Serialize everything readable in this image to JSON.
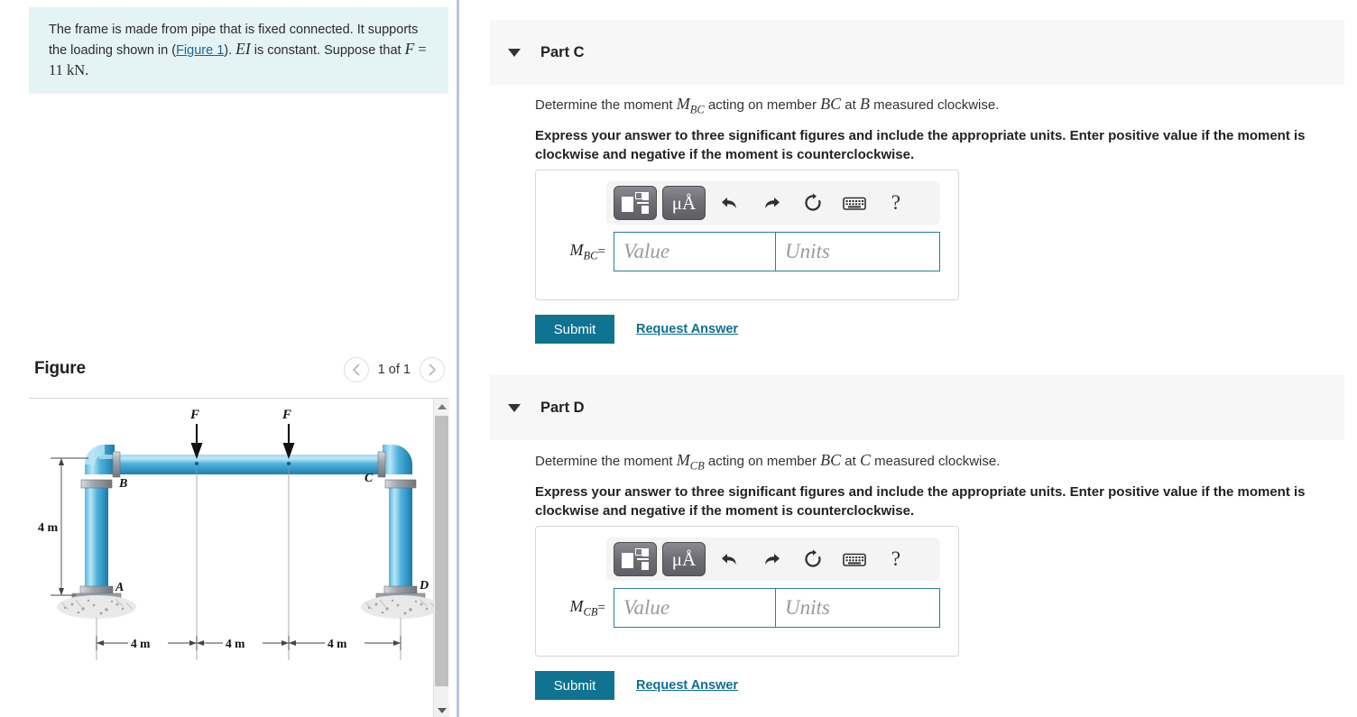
{
  "problem": {
    "line1_a": "The frame is made from pipe that is fixed connected. It supports the loading shown in (",
    "figure_link": "Figure 1",
    "line1_b": "). ",
    "EI": "EI",
    "line1_c": " is constant. Suppose that ",
    "F": "F",
    "line1_d": " = 11 kN."
  },
  "figure_panel": {
    "title": "Figure",
    "nav_prev_icon": "chevron-left-icon",
    "nav_next_icon": "chevron-right-icon",
    "counter": "1 of 1"
  },
  "diagram": {
    "load_label_left": "F",
    "load_label_right": "F",
    "node_A": "A",
    "node_B": "B",
    "node_C": "C",
    "node_D": "D",
    "height_dim": "4 m",
    "span_1": "4 m",
    "span_2": "4 m",
    "span_3": "4 m",
    "pipe_color": "#3aa8d8",
    "pipe_highlight": "#a9dcf0",
    "pipe_dark": "#1f7fad",
    "joint_color": "#9aa0a6"
  },
  "toolbar": {
    "template_icon": "math-template-icon",
    "units_label": "μÅ",
    "undo_icon": "undo-arrow-icon",
    "redo_icon": "redo-arrow-icon",
    "reset_icon": "reset-circular-arrow-icon",
    "keyboard_icon": "keyboard-icon",
    "help_label": "?"
  },
  "parts": [
    {
      "id": "part-c",
      "label": "Part C",
      "question_pre": "Determine the moment ",
      "question_sym": "M",
      "question_sub": "BC",
      "question_mid": " acting on member ",
      "question_member": "BC",
      "question_at": " at ",
      "question_point": "B",
      "question_post": " measured clockwise.",
      "instructions": "Express your answer to three significant figures and include the appropriate units. Enter positive value if the moment is clockwise and negative if the moment is counterclockwise.",
      "answer_symbol": "M",
      "answer_subscript": "BC",
      "answer_equals": "=",
      "value_placeholder": "Value",
      "units_placeholder": "Units",
      "value_current": "",
      "units_current": "",
      "submit_label": "Submit",
      "request_answer_label": "Request Answer"
    },
    {
      "id": "part-d",
      "label": "Part D",
      "question_pre": "Determine the moment ",
      "question_sym": "M",
      "question_sub": "CB",
      "question_mid": " acting on member ",
      "question_member": "BC",
      "question_at": " at ",
      "question_point": "C",
      "question_post": " measured clockwise.",
      "instructions": "Express your answer to three significant figures and include the appropriate units. Enter positive value if the moment is clockwise and negative if the moment is counterclockwise.",
      "answer_symbol": "M",
      "answer_subscript": "CB",
      "answer_equals": "=",
      "value_placeholder": "Value",
      "units_placeholder": "Units",
      "value_current": "",
      "units_current": "",
      "submit_label": "Submit",
      "request_answer_label": "Request Answer"
    }
  ],
  "colors": {
    "accent_teal": "#0f7391",
    "problem_bg": "#e4f4f4",
    "part_header_bg": "#f7f7f7",
    "divider": "#b6c6d8",
    "input_border": "#2a7f9e"
  }
}
